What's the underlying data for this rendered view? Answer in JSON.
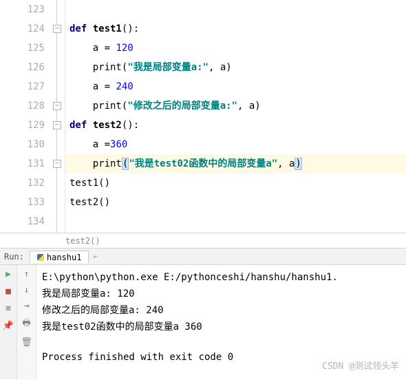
{
  "editor": {
    "lines": [
      {
        "n": "123",
        "tokens": []
      },
      {
        "n": "124",
        "tokens": [
          {
            "t": "kw",
            "v": "def "
          },
          {
            "t": "fn",
            "v": "test1"
          },
          {
            "t": "",
            "v": "():"
          }
        ],
        "indent": 0,
        "fold": "open"
      },
      {
        "n": "125",
        "tokens": [
          {
            "t": "",
            "v": "a = "
          },
          {
            "t": "num",
            "v": "120"
          }
        ],
        "indent": 1
      },
      {
        "n": "126",
        "tokens": [
          {
            "t": "",
            "v": "print("
          },
          {
            "t": "str",
            "v": "\"我是局部变量a:\""
          },
          {
            "t": "",
            "v": ", a)"
          }
        ],
        "indent": 1
      },
      {
        "n": "127",
        "tokens": [
          {
            "t": "",
            "v": "a = "
          },
          {
            "t": "num",
            "v": "240"
          }
        ],
        "indent": 1
      },
      {
        "n": "128",
        "tokens": [
          {
            "t": "",
            "v": "print("
          },
          {
            "t": "str",
            "v": "\"修改之后的局部变量a:\""
          },
          {
            "t": "",
            "v": ", a)"
          }
        ],
        "indent": 1,
        "fold": "close"
      },
      {
        "n": "129",
        "tokens": [
          {
            "t": "kw",
            "v": "def "
          },
          {
            "t": "fn",
            "v": "test2"
          },
          {
            "t": "",
            "v": "():"
          }
        ],
        "indent": 0,
        "fold": "open"
      },
      {
        "n": "130",
        "tokens": [
          {
            "t": "",
            "v": "a ="
          },
          {
            "t": "num",
            "v": "360"
          }
        ],
        "indent": 1
      },
      {
        "n": "131",
        "tokens": [
          {
            "t": "",
            "v": "print"
          },
          {
            "t": "paren",
            "v": "("
          },
          {
            "t": "str",
            "v": "\"我是test02函数中的局部变量a\""
          },
          {
            "t": "",
            "v": ", a"
          },
          {
            "t": "paren",
            "v": ")"
          }
        ],
        "indent": 1,
        "hl": true,
        "fold": "close"
      },
      {
        "n": "132",
        "tokens": [
          {
            "t": "",
            "v": "test1()"
          }
        ],
        "indent": 0
      },
      {
        "n": "133",
        "tokens": [
          {
            "t": "",
            "v": "test2()"
          }
        ],
        "indent": 0
      },
      {
        "n": "134",
        "tokens": [],
        "indent": 0
      }
    ]
  },
  "breadcrumb": "test2()",
  "run": {
    "label": "Run:",
    "tab": "hanshu1",
    "output": [
      "E:\\python\\python.exe E:/pythonceshi/hanshu/hanshu1.",
      "我是局部变量a: 120",
      "修改之后的局部变量a: 240",
      "我是test02函数中的局部变量a 360"
    ],
    "exit": "Process finished with exit code 0"
  },
  "watermark": "CSDN @测试领头羊"
}
